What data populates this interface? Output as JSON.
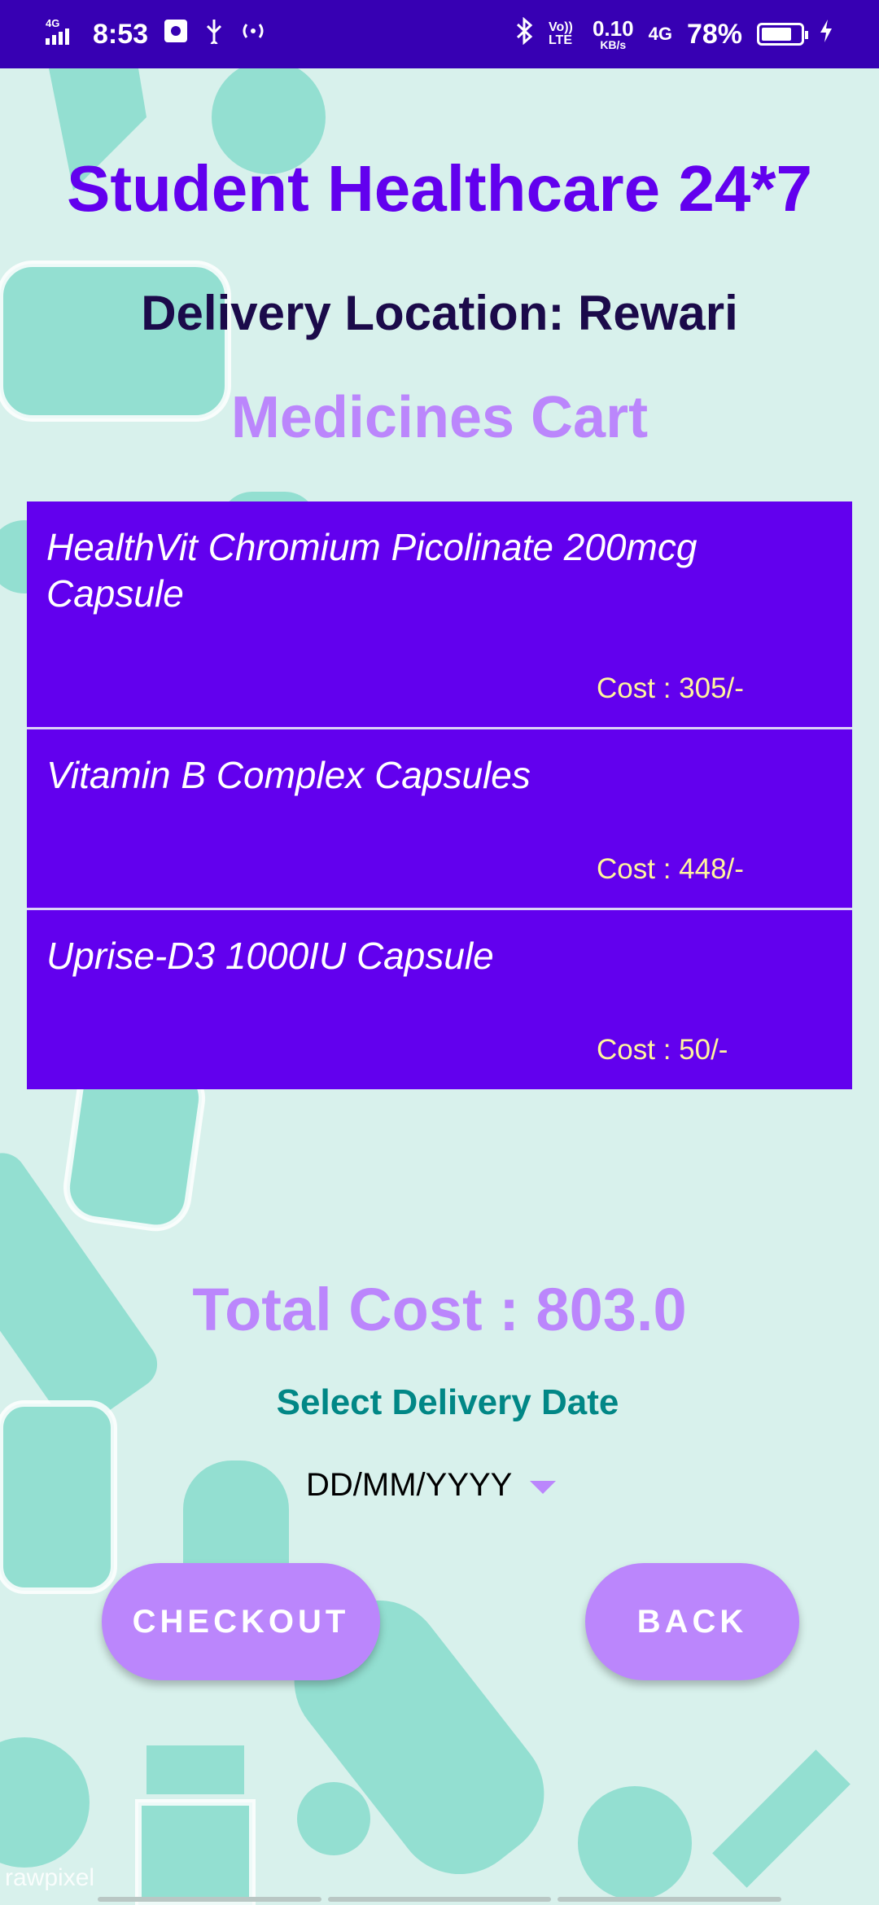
{
  "status_bar": {
    "network_type": "4G",
    "time": "8:53",
    "data_speed": "0.10",
    "data_speed_unit": "KB/s",
    "volte_label": "Vo)) LTE",
    "network_type_right": "4G",
    "battery_percent": "78%",
    "battery_level": 0.78
  },
  "header": {
    "app_title": "Student Healthcare 24*7",
    "delivery_location": "Delivery Location: Rewari",
    "cart_title": "Medicines Cart"
  },
  "cart": {
    "items": [
      {
        "name": "HealthVit Chromium Picolinate 200mcg Capsule",
        "cost": "Cost : 305/-"
      },
      {
        "name": "Vitamin B Complex Capsules",
        "cost": "Cost : 448/-"
      },
      {
        "name": "Uprise-D3 1000IU Capsule",
        "cost": "Cost : 50/-"
      }
    ]
  },
  "total_cost": "Total Cost : 803.0",
  "delivery": {
    "label": "Select Delivery Date",
    "date_value": "DD/MM/YYYY"
  },
  "buttons": {
    "checkout": "CHECKOUT",
    "back": "BACK"
  },
  "watermark": "rawpixel",
  "colors": {
    "primary": "#6200ee",
    "primary_dark": "#3700b3",
    "accent_light": "#bb86fc",
    "teal": "#018786",
    "cost_text": "#fff59d",
    "background": "#d8f1ec"
  }
}
